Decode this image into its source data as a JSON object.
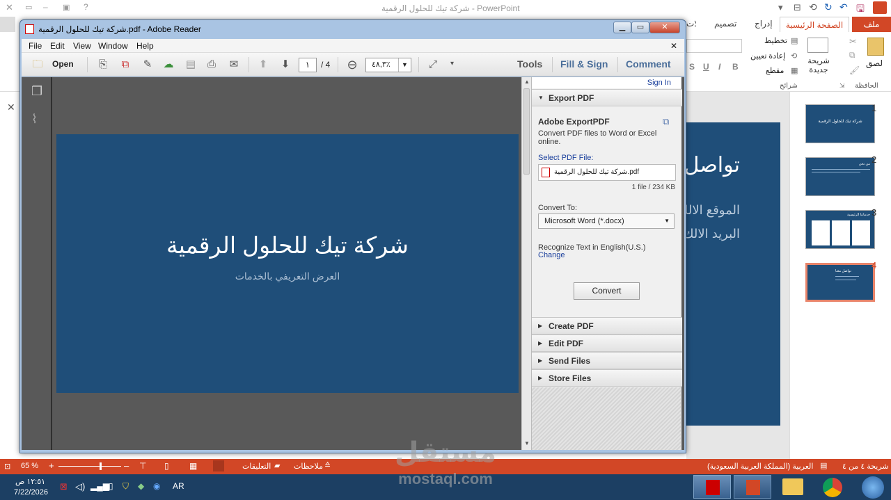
{
  "powerpoint": {
    "title": "شركة تيك للحلول الرقمية - PowerPoint",
    "tabs": [
      "ملف",
      "الصفحة الرئيسية",
      "إدراج",
      "تصميم",
      "انتقالات"
    ],
    "ribbon": {
      "paste": "لصق",
      "clipboard": "الحافظة",
      "new_slide": "شريحة جديدة",
      "layout": "تخطيط",
      "reset": "إعادة تعيين",
      "section": "مقطع",
      "slides_group": "شرائح",
      "font_buttons": [
        "S",
        "U",
        "I",
        "B"
      ]
    },
    "slide_edge": {
      "heading": "تواصل",
      "line1": "الموقع الالك",
      "line2": "البريد الالك"
    },
    "thumbnails": [
      {
        "num": "1",
        "text": "شركة تيك للحلول الرقمية"
      },
      {
        "num": "2",
        "text": "من نحن"
      },
      {
        "num": "3",
        "text": "خدماتنا الرئيسية"
      },
      {
        "num": "4",
        "text": "تواصل معنا"
      }
    ],
    "status": {
      "zoom": "65 %",
      "comments": "التعليقات",
      "notes": "ملاحظات",
      "language": "العربية (المملكة العربية السعودية)",
      "slide_counter": "شريحة ٤ من ٤"
    }
  },
  "taskbar": {
    "time": "١٢:٥١ ص",
    "date": "7/22/2026",
    "lang": "AR"
  },
  "watermark": {
    "arabic": "مستقل",
    "latin": "mostaql.com"
  },
  "reader": {
    "title": "شركة تيك للحلول الرقمية.pdf - Adobe Reader",
    "menu": [
      "File",
      "Edit",
      "View",
      "Window",
      "Help"
    ],
    "toolbar": {
      "open": "Open",
      "page_current": "١",
      "page_total": "/ 4",
      "zoom": "٤٨,٣٪",
      "tools": "Tools",
      "fill_sign": "Fill & Sign",
      "comment": "Comment"
    },
    "page": {
      "title": "شركة تيك للحلول الرقمية",
      "subtitle": "العرض التعريفي بالخدمات"
    },
    "panel": {
      "sign_in": "Sign In",
      "export_header": "Export PDF",
      "export_title": "Adobe ExportPDF",
      "export_desc": "Convert PDF files to Word or Excel online.",
      "select_label": "Select PDF File:",
      "file_name": "شركة تيك للحلول الرقمية.pdf",
      "file_info": "1 file / 234 KB",
      "convert_to": "Convert To:",
      "format": "Microsoft Word (*.docx)",
      "recognize": "Recognize Text in English(U.S.)",
      "change": "Change",
      "convert_btn": "Convert",
      "sections": [
        "Create PDF",
        "Edit PDF",
        "Send Files",
        "Store Files"
      ]
    }
  }
}
